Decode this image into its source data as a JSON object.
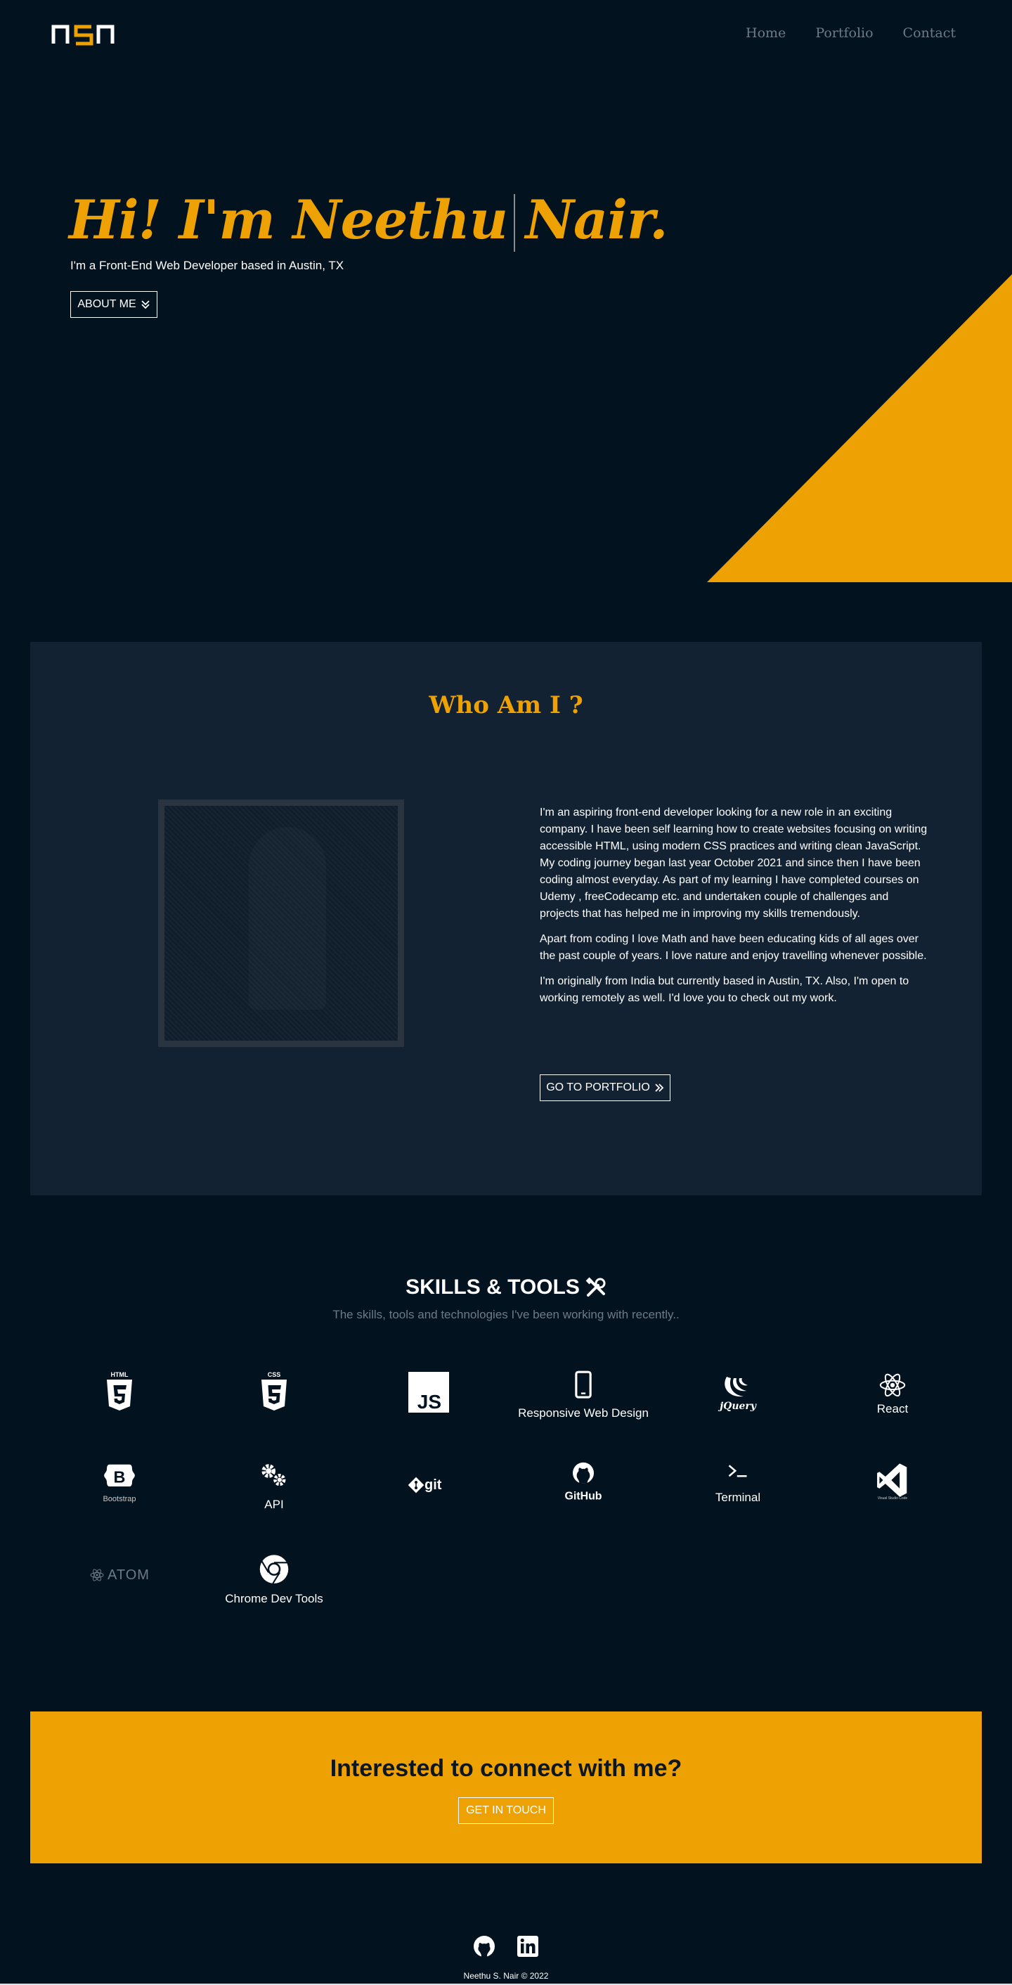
{
  "nav": {
    "logo_text": "nsn",
    "links": [
      {
        "label": "Home"
      },
      {
        "label": "Portfolio"
      },
      {
        "label": "Contact"
      }
    ]
  },
  "hero": {
    "title": "Hi! I'm Neethu Nair.",
    "subtitle": "I'm a Front-End Web Developer based in Austin, TX",
    "button_label": "ABOUT ME",
    "button_icon": "double-chevron-down-icon"
  },
  "about": {
    "title": "Who Am I ?",
    "paragraphs": [
      "I'm an aspiring front-end developer looking for a new role in an exciting company. I have been self learning how to create websites focusing on writing accessible HTML, using modern CSS practices and writing clean JavaScript. My coding journey began last year October 2021 and since then I have been coding almost everyday. As part of my learning I have completed courses on Udemy , freeCodecamp etc. and undertaken couple of challenges and projects that has helped me in improving my skills tremendously.",
      "Apart from coding I love Math and have been educating kids of all ages over the past couple of years. I love nature and enjoy travelling whenever possible.",
      "I'm originally from India but currently based in Austin, TX. Also, I'm open to working remotely as well. I'd love you to check out my work."
    ],
    "button_label": "GO TO PORTFOLIO",
    "button_icon": "double-chevron-right-icon"
  },
  "skills": {
    "title": "SKILLS & TOOLS",
    "title_icon": "tools-icon",
    "subtitle": "The skills, tools and technologies I've been working with recently..",
    "items": [
      {
        "icon": "html5-icon",
        "label": ""
      },
      {
        "icon": "css3-icon",
        "label": ""
      },
      {
        "icon": "javascript-icon",
        "label": ""
      },
      {
        "icon": "mobile-icon",
        "label": "Responsive Web Design"
      },
      {
        "icon": "jquery-icon",
        "label": ""
      },
      {
        "icon": "react-icon",
        "label": "React"
      },
      {
        "icon": "bootstrap-icon",
        "label": "Bootstrap"
      },
      {
        "icon": "gears-icon",
        "label": "API"
      },
      {
        "icon": "git-icon",
        "label": ""
      },
      {
        "icon": "github-icon",
        "label": ""
      },
      {
        "icon": "terminal-icon",
        "label": "Terminal"
      },
      {
        "icon": "vscode-icon",
        "label": "Visual Studio Code"
      },
      {
        "icon": "atom-icon",
        "label": "ATOM"
      },
      {
        "icon": "chrome-icon",
        "label": "Chrome Dev Tools"
      }
    ],
    "icon_text": {
      "html5": "HTML",
      "css3": "CSS",
      "js": "JS",
      "jquery": "jQuery",
      "git": "git",
      "github": "GitHub",
      "bootstrap_letter": "B"
    }
  },
  "connect": {
    "title": "Interested to connect with me?",
    "button_label": "GET IN TOUCH"
  },
  "footer": {
    "social": [
      {
        "icon": "github-icon"
      },
      {
        "icon": "linkedin-icon"
      }
    ],
    "copyright": "Neethu S. Nair © 2022"
  },
  "colors": {
    "background": "#03121f",
    "panel": "#132233",
    "accent": "#eea103",
    "muted": "#6e7a85"
  }
}
